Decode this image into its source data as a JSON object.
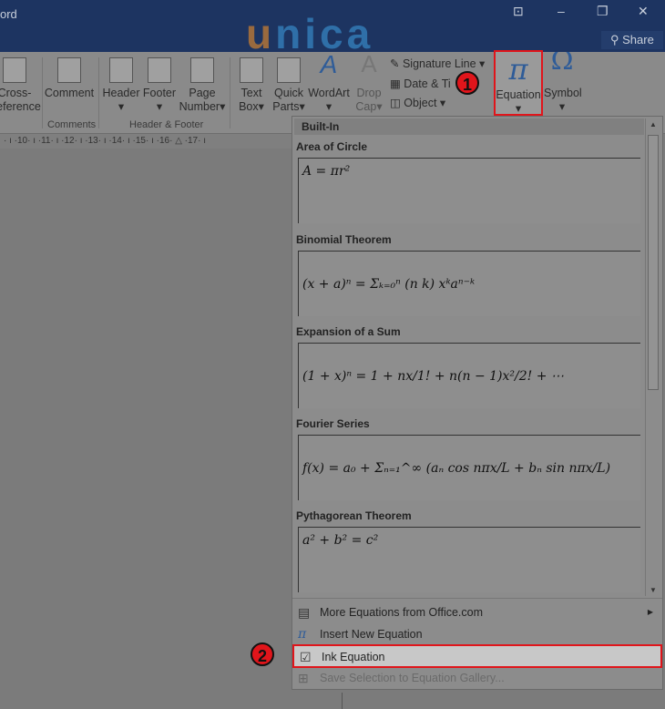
{
  "title_bar": {
    "app_title": "ord",
    "logo": "unica",
    "share_label": "Share"
  },
  "ribbon": {
    "buttons": [
      "Cross-\nReference",
      "Comment",
      "Header",
      "Footer",
      "Page Number",
      "Text Box",
      "Quick Parts",
      "WordArt",
      "Drop Cap",
      "Equation",
      "Symbol"
    ],
    "labels": {
      "cross_ref_1": "Cross-",
      "cross_ref_2": "ference",
      "comment": "Comment",
      "header": "Header",
      "footer": "Footer",
      "page_1": "Page",
      "page_2": "Number",
      "text_1": "Text",
      "text_2": "Box",
      "quick_1": "Quick",
      "quick_2": "Parts",
      "wordart": "WordArt",
      "drop_1": "Drop",
      "drop_2": "Cap",
      "signature": "Signature Line",
      "date": "Date & Ti",
      "object": "Object",
      "equation": "Equation",
      "symbol": "Symbol"
    },
    "groups": {
      "comments": "Comments",
      "header_footer": "Header & Footer"
    }
  },
  "ruler": "· ı ·10· ı ·11· ı ·12· ı ·13· ı ·14· ı ·15· ı ·16· △ ·17· ı",
  "badges": {
    "one": "1",
    "two": "2"
  },
  "accent_color": "#e0151b",
  "gallery": {
    "header": "Built-In",
    "items": [
      {
        "title": "Area of Circle",
        "equation": "A = πr²"
      },
      {
        "title": "Binomial Theorem",
        "equation": "(x + a)ⁿ = Σₖ₌₀ⁿ (n k) xᵏaⁿ⁻ᵏ"
      },
      {
        "title": "Expansion of a Sum",
        "equation": "(1 + x)ⁿ = 1 + nx/1! + n(n − 1)x²/2! + ⋯"
      },
      {
        "title": "Fourier Series",
        "equation": "f(x) = a₀ + Σₙ₌₁^∞ (aₙ cos nπx/L + bₙ sin nπx/L)"
      },
      {
        "title": "Pythagorean Theorem",
        "equation": "a² + b² = c²"
      }
    ]
  },
  "menu": [
    {
      "label": "More Equations from Office.com",
      "icon": "office-equations-icon"
    },
    {
      "label": "Insert New Equation",
      "icon": "pi-icon"
    },
    {
      "label": "Ink Equation",
      "icon": "ink-equation-icon"
    },
    {
      "label": "Save Selection to Equation Gallery...",
      "icon": "save-equation-icon"
    }
  ]
}
